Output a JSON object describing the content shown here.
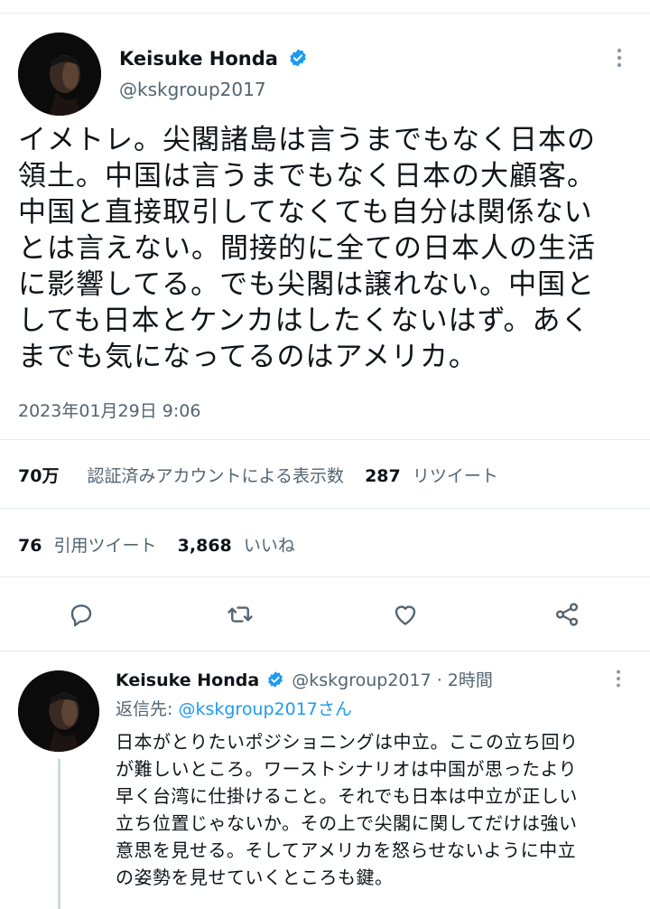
{
  "main_tweet": {
    "author_name": "Keisuke Honda",
    "author_handle": "@kskgroup2017",
    "lines": [
      "イメトレ。尖閣諸島は言うまでもなく日本の",
      "領土。中国は言うまでもなく日本の大顧客。",
      "中国と直接取引してなくても自分は関係ない",
      "とは言えない。間接的に全ての日本人の生活",
      "に影響してる。でも尖閣は譲れない。中国と",
      "しても日本とケンカはしたくないはず。あく",
      "までも気になってるのはアメリカ。"
    ],
    "timestamp": "2023年01月29日 9:06"
  },
  "stats": {
    "views_count": "70万",
    "views_label": "認証済みアカウントによる表示数",
    "retweets_count": "287",
    "retweets_label": "リツイート",
    "quotes_count": "76",
    "quotes_label": "引用ツイート",
    "likes_count": "3,868",
    "likes_label": "いいね"
  },
  "actions": [
    "reply-icon",
    "retweet-icon",
    "like-icon",
    "share-icon"
  ],
  "reply_tweet": {
    "author_name": "Keisuke Honda",
    "handle_time": "@kskgroup2017 · 2時間",
    "reply_prefix": "返信先: ",
    "reply_to": "@kskgroup2017さん",
    "lines": [
      "日本がとりたいポジショニングは中立。ここの立ち回り",
      "が難しいところ。ワーストシナリオは中国が思ったより",
      "早く台湾に仕掛けること。それでも日本は中立が正しい",
      "立ち位置じゃないか。その上で尖閣に関してだけは強い",
      "意思を見せる。そしてアメリカを怒らせないように中立",
      "の姿勢を見せていくところも鍵。"
    ]
  },
  "colors": {
    "accent": "#1d9bf0",
    "text_primary": "#0f1419",
    "text_secondary": "#536471",
    "divider": "#e6ecf0"
  }
}
